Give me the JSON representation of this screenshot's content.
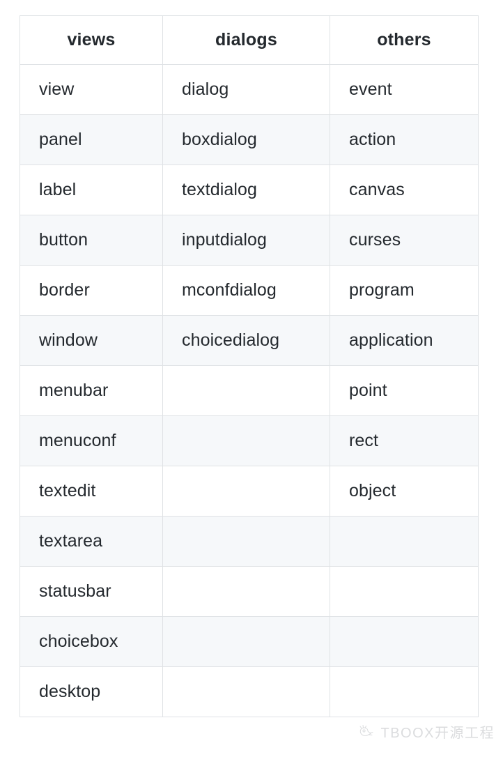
{
  "table": {
    "headers": [
      "views",
      "dialogs",
      "others"
    ],
    "rows": [
      [
        "view",
        "dialog",
        "event"
      ],
      [
        "panel",
        "boxdialog",
        "action"
      ],
      [
        "label",
        "textdialog",
        "canvas"
      ],
      [
        "button",
        "inputdialog",
        "curses"
      ],
      [
        "border",
        "mconfdialog",
        "program"
      ],
      [
        "window",
        "choicedialog",
        "application"
      ],
      [
        "menubar",
        "",
        "point"
      ],
      [
        "menuconf",
        "",
        "rect"
      ],
      [
        "textedit",
        "",
        "object"
      ],
      [
        "textarea",
        "",
        ""
      ],
      [
        "statusbar",
        "",
        ""
      ],
      [
        "choicebox",
        "",
        ""
      ],
      [
        "desktop",
        "",
        ""
      ]
    ]
  },
  "watermark": {
    "text": "TBOOX开源工程",
    "icon": "tboox-mascot-logo"
  },
  "colors": {
    "border": "#dfe2e5",
    "stripe": "#f6f8fa",
    "text": "#24292e",
    "background": "#ffffff",
    "watermark_text": "#8a8f95"
  }
}
